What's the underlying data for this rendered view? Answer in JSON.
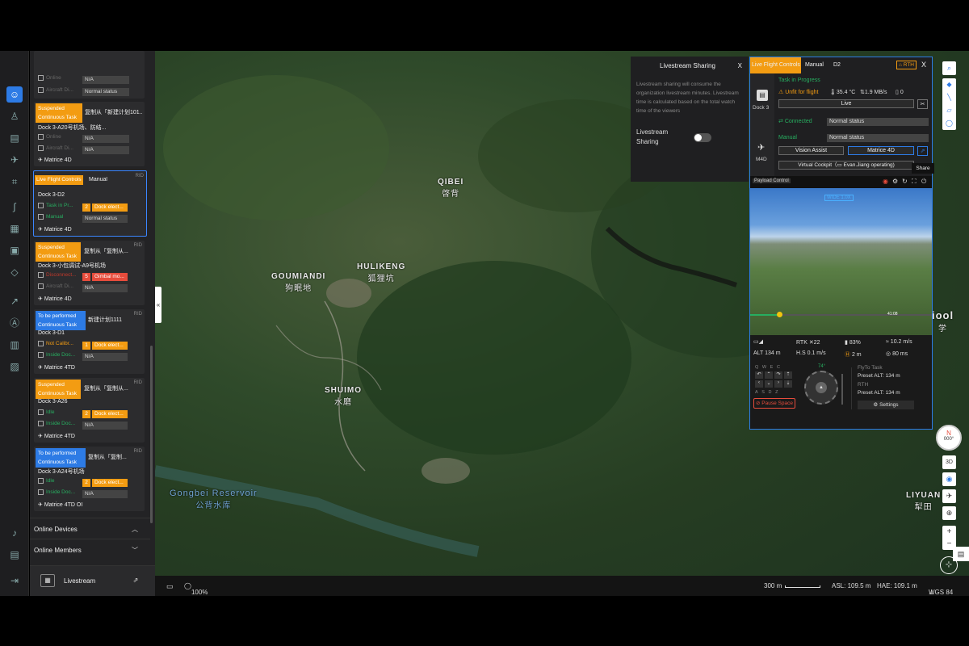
{
  "sidebar": {
    "items": [
      {
        "name": "team-icon",
        "glyph": "☺"
      },
      {
        "name": "people-icon",
        "glyph": "♙"
      },
      {
        "name": "dock-icon",
        "glyph": "▤"
      },
      {
        "name": "aircraft-icon",
        "glyph": "✈"
      },
      {
        "name": "map-icon",
        "glyph": "⌗"
      },
      {
        "name": "route-icon",
        "glyph": "∫"
      },
      {
        "name": "calendar-icon",
        "glyph": "▦"
      },
      {
        "name": "media-icon",
        "glyph": "▣"
      },
      {
        "name": "model-icon",
        "glyph": "◇"
      },
      {
        "name": "chart-icon",
        "glyph": "↗"
      },
      {
        "name": "flight-area-icon",
        "glyph": "Ⓐ"
      },
      {
        "name": "document-icon",
        "glyph": "▥"
      },
      {
        "name": "log-icon",
        "glyph": "▨"
      }
    ],
    "bottom": [
      {
        "name": "bell-icon",
        "glyph": "♪"
      },
      {
        "name": "report-icon",
        "glyph": "▤"
      },
      {
        "name": "logout-icon",
        "glyph": "⇥"
      }
    ]
  },
  "panel": {
    "card0": {
      "r1": "N/A",
      "r2": "Normal status"
    },
    "card1": {
      "chip1": "Suspended",
      "chip2": "Continuous Task",
      "plan": "复制从「新建计划101...",
      "dock": "Dock 3-A20号机场、防结...",
      "r1": "N/A",
      "r2": "N/A",
      "drone": "Matrice 4D"
    },
    "card2": {
      "chip1": "Live Flight Controls",
      "chip2": "Manual",
      "rid": "RID",
      "dock": "Dock 3-D2",
      "task": "Task in Pr...",
      "count": "2",
      "alert": "Dock elect...",
      "mode": "Manual",
      "status": "Normal status",
      "drone": "Matrice 4D"
    },
    "card3": {
      "chip1": "Suspended",
      "chip2": "Continuous Task",
      "plan": "复制从「复制从...",
      "rid": "RID",
      "dock": "Dock 3-小包调试-A9号机场",
      "count": "5",
      "alert": "Gimbal mo...",
      "r2": "N/A",
      "drone": "Matrice 4D"
    },
    "card4": {
      "chip1": "To be performed",
      "chip2": "Continuous Task",
      "plan": "新建计划1111",
      "rid": "RID",
      "dock": "Dock 3-D1",
      "task": "Not Calibr...",
      "count": "1",
      "alert": "Dock elect...",
      "mode": "Inside Doc...",
      "r2": "N/A",
      "drone": "Matrice 4TD"
    },
    "card5": {
      "chip1": "Suspended",
      "chip2": "Continuous Task",
      "plan": "复制从「复制从...",
      "rid": "RID",
      "dock": "Dock 3-A26",
      "task": "Idle",
      "count": "2",
      "alert": "Dock elect...",
      "mode": "Inside Doc...",
      "r2": "N/A",
      "drone": "Matrice 4TD"
    },
    "card6": {
      "chip1": "To be performed",
      "chip2": "Continuous Task",
      "plan": "复制从「复制...",
      "rid": "RID",
      "dock": "Dock 3-A24号机场",
      "task": "Idle",
      "count": "2",
      "alert": "Dock elect...",
      "mode": "Inside Doc...",
      "r2": "N/A",
      "drone": "Matrice 4TD",
      "extra": "OI"
    },
    "online_devices": "Online Devices",
    "online_members": "Online Members",
    "livestream": "Livestream"
  },
  "map": {
    "labels": [
      {
        "en": "QIBEI",
        "cn": "啓背"
      },
      {
        "en": "HULIKENG",
        "cn": "狐狸坑"
      },
      {
        "en": "GOUMIANDI",
        "cn": "狗眠地"
      },
      {
        "en": "SHUIMO",
        "cn": "水磨"
      },
      {
        "en": "Gongbei Reservoir",
        "cn": "公背水库"
      },
      {
        "en": "LIYUAN",
        "cn": "犁田"
      },
      {
        "en": "iool",
        "cn": "学"
      }
    ]
  },
  "share": {
    "title": "Livestream Sharing",
    "close": "X",
    "desc": "Livestream sharing will consume the organization livestream minutes. Livestream time is calculated based on the total watch time of the viewers",
    "toggle_label": "Livestream Sharing",
    "toggle_on": false
  },
  "flight": {
    "tab_live": "Live Flight Controls",
    "tab_manual": "Manual",
    "tab_d2": "D2",
    "rth": "RTH",
    "close": "X",
    "dock_label": "Dock 3",
    "drone_label": "M4D",
    "task_status": "Task in Progress",
    "unfit": "Unfit for flight",
    "temp": "35.4 °C",
    "rate": "1.9 MB/s",
    "count": "0",
    "live": "Live",
    "connected": "Connected",
    "conn_status": "Normal status",
    "manual": "Manual",
    "manual_status": "Normal status",
    "vision_assist": "Vision Assist",
    "drone_select": "Matrice 4D",
    "virtual_cockpit": "Virtual Cockpit（",
    "operator": "Evan.Jiang operating)",
    "share_tip": "Share",
    "payload_control": "Payload Control",
    "wide": "WIDE 1.0X",
    "progress": 0.16,
    "time_mark": "41:08",
    "rtk": "RTK",
    "rtk_count": "22",
    "battery": "83%",
    "wind": "10.2 m/s",
    "alt": "ALT 134 m",
    "hs": "H.S 0.1 m/s",
    "h": "2 m",
    "dist": "80 ms",
    "keys": [
      "Q",
      "W",
      "E",
      "C",
      "A",
      "S",
      "D",
      "Z"
    ],
    "heading": "74°",
    "pause": "Pause Space",
    "flyto": "FlyTo Task",
    "flyto_alt": "Preset ALT: 134 m",
    "rth_label": "RTH",
    "rth_alt": "Preset ALT: 134 m",
    "settings": "Settings"
  },
  "compass": {
    "n": "N",
    "deg": "000°"
  },
  "maptools": {
    "threed": "3D"
  },
  "bottom": {
    "zoom": "100%",
    "scale": "300 m",
    "asl": "ASL: 109.5 m",
    "hae": "HAE: 109.1 m",
    "wgs": "WGS 84"
  }
}
